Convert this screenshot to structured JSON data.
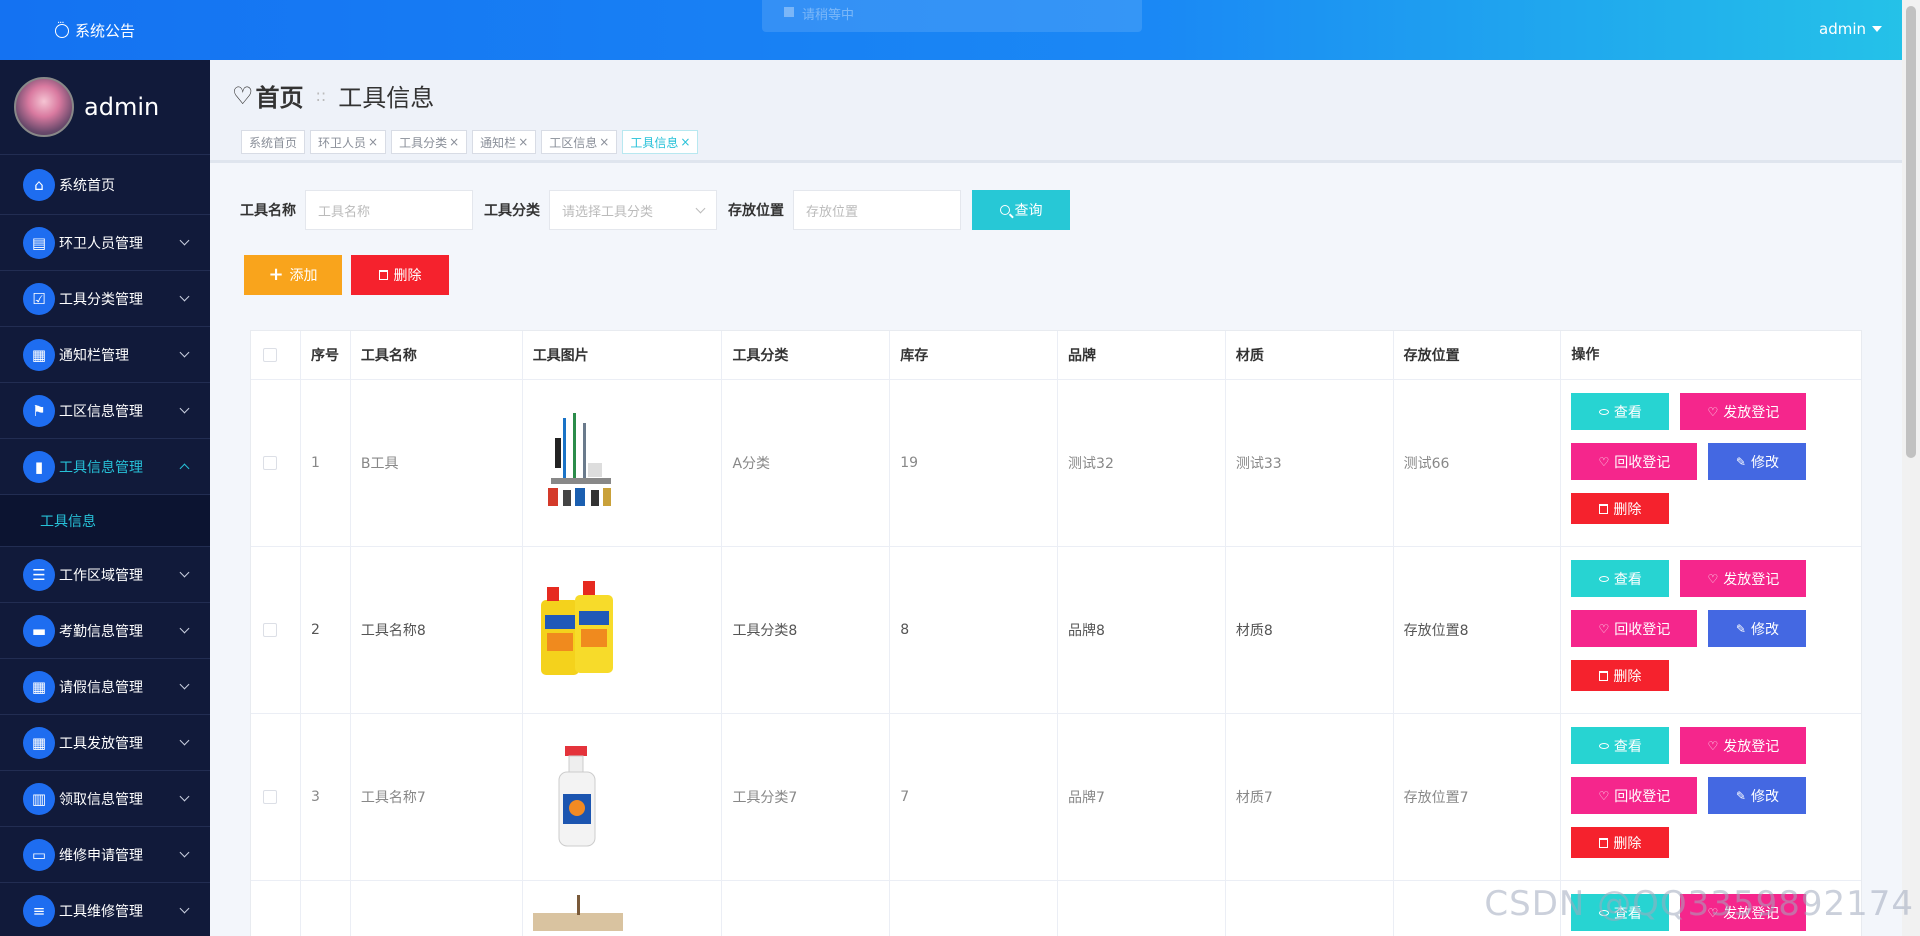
{
  "topbar": {
    "notice_label": "系统公告",
    "toast_text": "请稍等中",
    "user": "admin",
    "colors": {
      "start": "#1472f2",
      "end": "#25c3e8"
    }
  },
  "sidebar": {
    "username": "admin",
    "items": [
      {
        "label": "系统首页",
        "icon": "home-icon",
        "expandable": false
      },
      {
        "label": "环卫人员管理",
        "icon": "clipboard-icon",
        "expandable": true
      },
      {
        "label": "工具分类管理",
        "icon": "checklist-icon",
        "expandable": true
      },
      {
        "label": "通知栏管理",
        "icon": "grid-icon",
        "expandable": true
      },
      {
        "label": "工区信息管理",
        "icon": "flag-icon",
        "expandable": true
      },
      {
        "label": "工具信息管理",
        "icon": "bar-chart-icon",
        "expandable": true,
        "active": true
      },
      {
        "label": "工作区域管理",
        "icon": "list-icon",
        "expandable": true
      },
      {
        "label": "考勤信息管理",
        "icon": "ticket-icon",
        "expandable": true
      },
      {
        "label": "请假信息管理",
        "icon": "grid-icon",
        "expandable": true
      },
      {
        "label": "工具发放管理",
        "icon": "grid-icon",
        "expandable": true
      },
      {
        "label": "领取信息管理",
        "icon": "book-icon",
        "expandable": true
      },
      {
        "label": "维修申请管理",
        "icon": "monitor-icon",
        "expandable": true
      },
      {
        "label": "工具维修管理",
        "icon": "sliders-icon",
        "expandable": true
      }
    ],
    "submenu_active": "工具信息",
    "colors": {
      "bg": "#111a3a",
      "accent": "#27c1d8",
      "icon_bg": "#1e6df0"
    }
  },
  "breadcrumb": {
    "home": "首页",
    "separator": "::",
    "current": "工具信息"
  },
  "tags": [
    {
      "label": "系统首页",
      "closable": false
    },
    {
      "label": "环卫人员",
      "closable": true
    },
    {
      "label": "工具分类",
      "closable": true
    },
    {
      "label": "通知栏",
      "closable": true
    },
    {
      "label": "工区信息",
      "closable": true
    },
    {
      "label": "工具信息",
      "closable": true,
      "active": true
    }
  ],
  "search": {
    "name_label": "工具名称",
    "name_placeholder": "工具名称",
    "category_label": "工具分类",
    "category_placeholder": "请选择工具分类",
    "location_label": "存放位置",
    "location_placeholder": "存放位置",
    "button": "查询"
  },
  "actions": {
    "add": "添加",
    "delete": "删除"
  },
  "table": {
    "columns": [
      "序号",
      "工具名称",
      "工具图片",
      "工具分类",
      "库存",
      "品牌",
      "材质",
      "存放位置",
      "操作"
    ],
    "rows": [
      {
        "index": "1",
        "name": "B工具",
        "image": "tool-set-image",
        "category": "A分类",
        "stock": "19",
        "brand": "测试32",
        "material": "测试33",
        "location": "测试66",
        "muted": true
      },
      {
        "index": "2",
        "name": "工具名称8",
        "image": "detergent-bottles-image",
        "category": "工具分类8",
        "stock": "8",
        "brand": "品牌8",
        "material": "材质8",
        "location": "存放位置8",
        "muted": false
      },
      {
        "index": "3",
        "name": "工具名称7",
        "image": "spray-bottle-image",
        "category": "工具分类7",
        "stock": "7",
        "brand": "品牌7",
        "material": "材质7",
        "location": "存放位置7",
        "muted": true
      }
    ],
    "ops": {
      "view": "查看",
      "issue": "发放登记",
      "recycle": "回收登记",
      "edit": "修改",
      "delete": "删除"
    },
    "partial_row_ops": {
      "view": "查看",
      "issue": "发放登记"
    }
  },
  "watermark": "CSDN @QQ3359892174"
}
